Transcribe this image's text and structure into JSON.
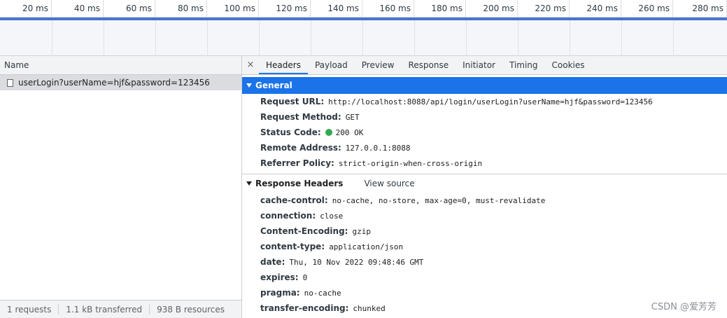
{
  "timeline": {
    "ticks": [
      "20 ms",
      "40 ms",
      "60 ms",
      "80 ms",
      "100 ms",
      "120 ms",
      "140 ms",
      "160 ms",
      "180 ms",
      "200 ms",
      "220 ms",
      "240 ms",
      "260 ms",
      "280 ms"
    ]
  },
  "requests": {
    "column_name": "Name",
    "rows": [
      {
        "name": "userLogin?userName=hjf&password=123456"
      }
    ],
    "footer": {
      "requests": "1 requests",
      "transferred": "1.1 kB transferred",
      "resources": "938 B resources"
    }
  },
  "tabs": {
    "close": "×",
    "items": [
      "Headers",
      "Payload",
      "Preview",
      "Response",
      "Initiator",
      "Timing",
      "Cookies"
    ],
    "active": "Headers"
  },
  "general": {
    "title": "General",
    "fields": [
      {
        "key": "Request URL:",
        "value": "http://localhost:8088/api/login/userLogin?userName=hjf&password=123456"
      },
      {
        "key": "Request Method:",
        "value": "GET"
      },
      {
        "key": "Status Code:",
        "value": "200 OK",
        "status_color": "#34a853"
      },
      {
        "key": "Remote Address:",
        "value": "127.0.0.1:8088"
      },
      {
        "key": "Referrer Policy:",
        "value": "strict-origin-when-cross-origin"
      }
    ]
  },
  "response_headers": {
    "title": "Response Headers",
    "view_source": "View source",
    "fields": [
      {
        "key": "cache-control:",
        "value": "no-cache, no-store, max-age=0, must-revalidate"
      },
      {
        "key": "connection:",
        "value": "close"
      },
      {
        "key": "Content-Encoding:",
        "value": "gzip"
      },
      {
        "key": "content-type:",
        "value": "application/json"
      },
      {
        "key": "date:",
        "value": "Thu, 10 Nov 2022 09:48:46 GMT"
      },
      {
        "key": "expires:",
        "value": "0"
      },
      {
        "key": "pragma:",
        "value": "no-cache"
      },
      {
        "key": "transfer-encoding:",
        "value": "chunked"
      }
    ]
  },
  "watermark": "CSDN @爱芳芳",
  "colors": {
    "accent": "#1a73e8",
    "timeline_bar": "#4a74d0"
  }
}
